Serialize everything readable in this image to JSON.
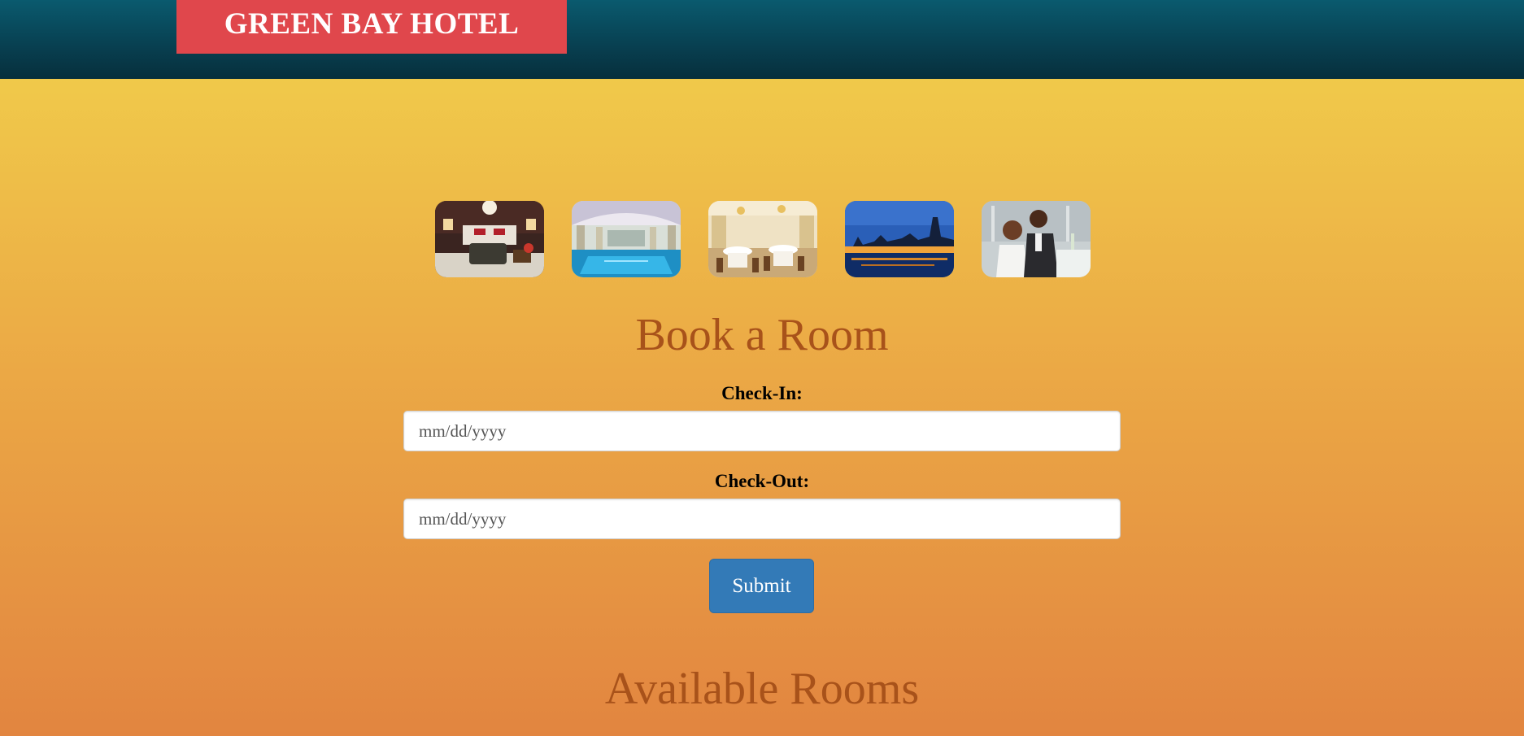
{
  "header": {
    "logo_text": "GREEN BAY HOTEL"
  },
  "gallery": {
    "images": [
      {
        "icon": "bedroom-photo"
      },
      {
        "icon": "indoor-pool-photo"
      },
      {
        "icon": "restaurant-photo"
      },
      {
        "icon": "london-night-photo"
      },
      {
        "icon": "couple-dining-photo"
      }
    ]
  },
  "booking": {
    "title": "Book a Room",
    "checkin_label": "Check-In:",
    "checkin_placeholder": "mm/dd/yyyy",
    "checkout_label": "Check-Out:",
    "checkout_placeholder": "mm/dd/yyyy",
    "submit_label": "Submit"
  },
  "rooms": {
    "title": "Available Rooms"
  },
  "colors": {
    "header_bg": "#083f50",
    "logo_bg": "#e0474c",
    "title_color": "#a8521a",
    "button_bg": "#337ab7"
  }
}
